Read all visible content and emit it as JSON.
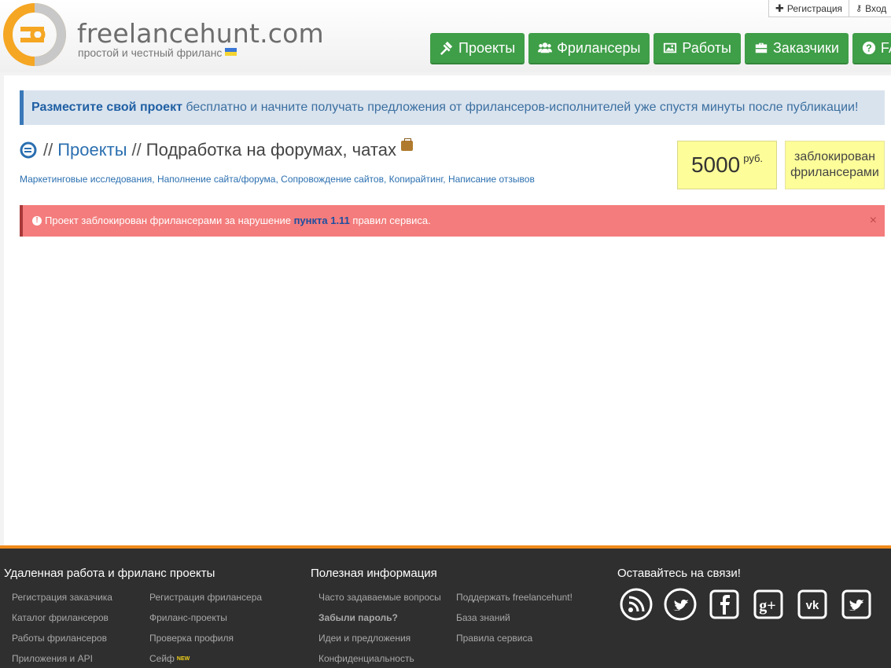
{
  "header": {
    "logo_name": "freelancehunt.com",
    "logo_tagline": "простой и честный фриланс",
    "topbar": [
      {
        "label": "Регистрация",
        "icon": "plus-icon"
      },
      {
        "label": "Вход",
        "icon": "key-icon"
      }
    ],
    "nav": [
      {
        "label": "Проекты",
        "icon": "gavel-icon"
      },
      {
        "label": "Фрилансеры",
        "icon": "users-icon"
      },
      {
        "label": "Работы",
        "icon": "picture-icon"
      },
      {
        "label": "Заказчики",
        "icon": "briefcase-icon"
      },
      {
        "label": "FAQ",
        "icon": "question-icon"
      }
    ],
    "accent_color": "#3f9e48"
  },
  "promo": {
    "link": "Разместите свой проект",
    "text": " бесплатно и начните получать предложения от фрилансеров-исполнителей уже спустя минуты после публикации!"
  },
  "project": {
    "breadcrumb_sep": "//",
    "breadcrumb_link": "Проекты",
    "title": "Подработка на форумах, чатах",
    "tags": [
      "Маркетинговые исследования",
      "Наполнение сайта/форума",
      "Сопровождение сайтов",
      "Копирайтинг",
      "Написание отзывов"
    ],
    "budget": "5000",
    "currency": "руб.",
    "status_line1": "заблокирован",
    "status_line2": "фрилансерами"
  },
  "alert": {
    "text_before": "Проект заблокирован фрилансерами за нарушение ",
    "link": "пункта 1.11",
    "text_after": " правил сервиса.",
    "close": "×",
    "color": "#f47c7c"
  },
  "footer": {
    "col1_title": "Удаленная работа и фриланс проекты",
    "col1_links_a": [
      "Регистрация заказчика",
      "Каталог фрилансеров",
      "Работы фрилансеров",
      "Приложения и API"
    ],
    "col1_links_b": [
      "Регистрация фрилансера",
      "Фриланс-проекты",
      "Проверка профиля",
      "Сейф"
    ],
    "new_badge": "NEW",
    "col2_title": "Полезная информация",
    "col2_links_a": [
      "Часто задаваемые вопросы",
      "Забыли пароль?",
      "Идеи и предложения",
      "Конфиденциальность"
    ],
    "col2_links_b": [
      "Поддержать freelancehunt!",
      "База знаний",
      "Правила сервиса"
    ],
    "col3_title": "Оставайтесь на связи!",
    "social": [
      "rss-icon",
      "twitter-icon",
      "facebook-icon",
      "google-plus-icon",
      "vk-icon",
      "twitter-icon"
    ],
    "border_color": "#f08a1a"
  }
}
